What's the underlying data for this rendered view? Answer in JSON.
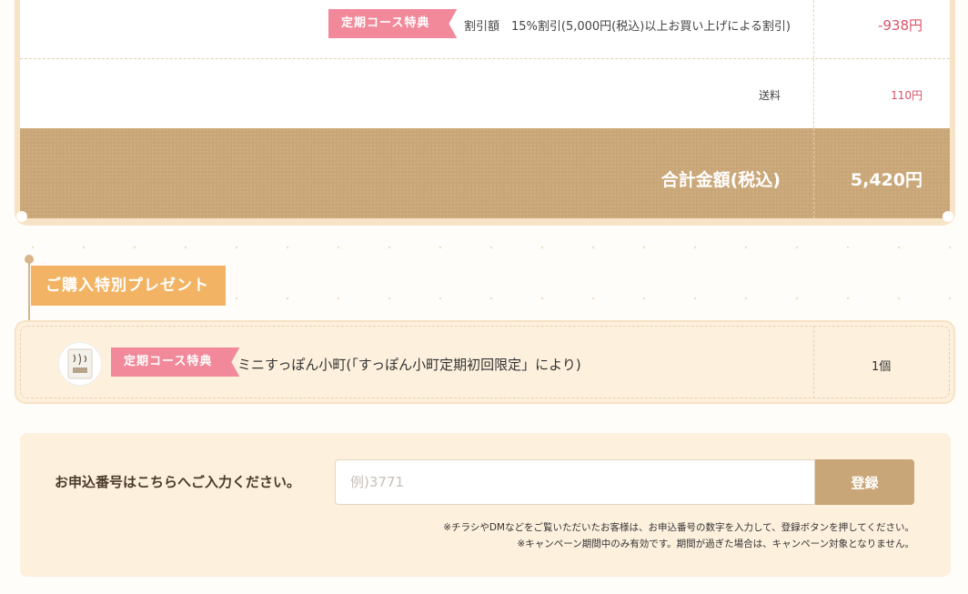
{
  "totals": {
    "discount": {
      "badge": "定期コース特典",
      "label": "割引額　15%割引(5,000円(税込)以上お買い上げによる割引)",
      "value": "-938円"
    },
    "shipping": {
      "label": "送料",
      "value": "110円"
    },
    "total": {
      "label": "合計金額(税込)",
      "value": "5,420円"
    }
  },
  "present": {
    "title": "ご購入特別プレゼント",
    "item": {
      "thumbnail_icon": "product-package-icon",
      "badge": "定期コース特典",
      "name": "ミニすっぽん小町(「すっぽん小町定期初回限定」により)",
      "quantity": "1個"
    }
  },
  "application": {
    "label": "お申込番号はこちらへご入力ください。",
    "input": {
      "value": "",
      "placeholder": "例)3771"
    },
    "button_label": "登録",
    "notes": [
      "※チラシやDMなどをご覧いただいたお客様は、お申込番号の数字を入力して、登録ボタンを押してください。",
      "※キャンペーン期間中のみ有効です。期間が過ぎた場合は、キャンペーン対象となりません。"
    ]
  },
  "colors": {
    "accent_brown": "#c9a677",
    "badge_pink": "#f1899a",
    "price_red": "#d9546a",
    "present_orange": "#f2b464",
    "panel_cream": "#fdf0dd"
  }
}
